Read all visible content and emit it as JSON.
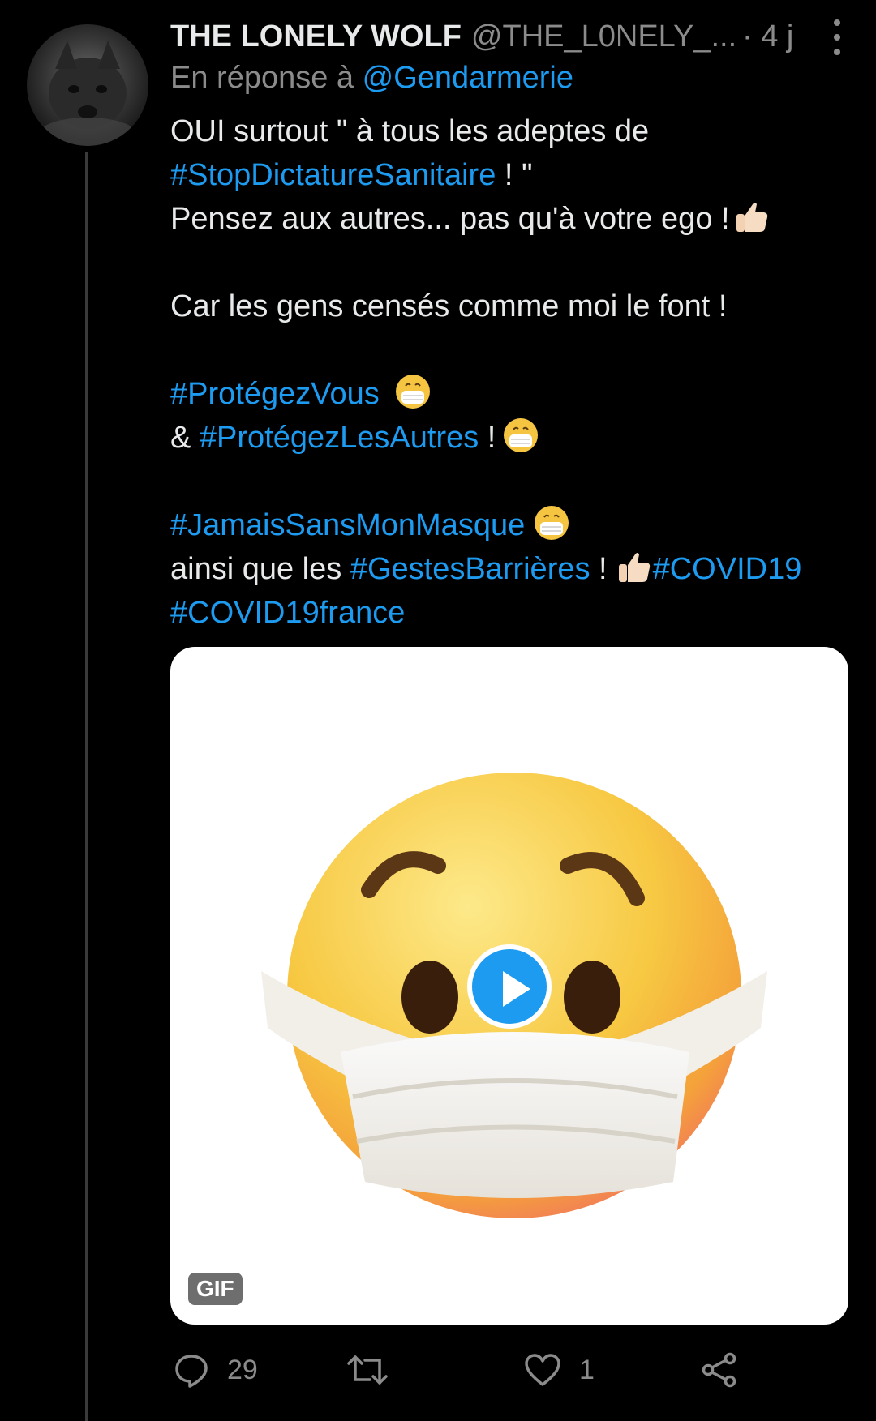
{
  "tweet": {
    "display_name": "THE LONELY WOLF",
    "handle": "@THE_L0NELY_...",
    "time": "· 4 j",
    "reply_prefix": "En réponse à",
    "reply_to": "@Gendarmerie",
    "lines": {
      "l1": "OUI surtout \" à tous les adeptes de",
      "l2_tag": "#StopDictatureSanitaire",
      "l2_rest": " ! \"",
      "l3": "Pensez aux autres... pas qu'à  votre ego !",
      "l5": "Car les gens censés comme moi le font !",
      "l7_tag": "#ProtégezVous",
      "l8_prefix": "& ",
      "l8_tag": "#ProtégezLesAutres",
      "l8_rest": " !",
      "l10_tag": "#JamaisSansMonMasque",
      "l11_prefix": "ainsi que les ",
      "l11_tag": "#GestesBarrières",
      "l11_rest": " !",
      "l11_tag2": "#COVID19",
      "l12_tag": "#COVID19france"
    },
    "media": {
      "type": "GIF",
      "badge": "GIF",
      "subject": "face-with-medical-mask emoji"
    },
    "actions": {
      "reply_count": "29",
      "retweet_count": "",
      "like_count": "1"
    }
  },
  "colors": {
    "background": "#000000",
    "text": "#e7e9ea",
    "secondary": "#8b8b8b",
    "link": "#1d9bf0"
  }
}
